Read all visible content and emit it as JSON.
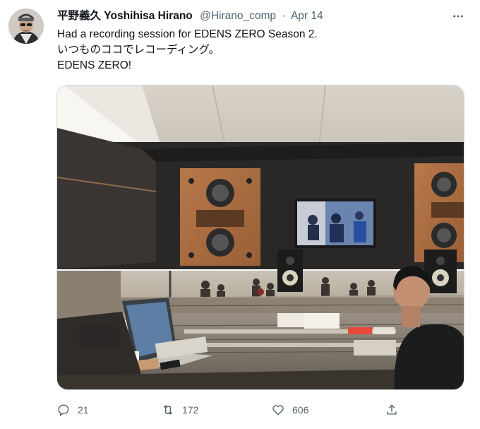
{
  "tweet": {
    "display_name": "平野義久  Yoshihisa Hirano",
    "handle": "@Hirano_comp",
    "separator": "·",
    "date": "Apr 14",
    "lines": [
      "Had a recording session for EDENS ZERO Season 2.",
      "いつものココでレコーディング。",
      "EDENS ZERO!"
    ]
  },
  "actions": {
    "reply_count": "21",
    "retweet_count": "172",
    "like_count": "606"
  },
  "icons": {
    "more": "more-horizontal-icon",
    "reply": "reply-icon",
    "retweet": "retweet-icon",
    "like": "heart-icon",
    "share": "share-icon"
  },
  "colors": {
    "text_primary": "#0f1419",
    "text_secondary": "#536471"
  }
}
